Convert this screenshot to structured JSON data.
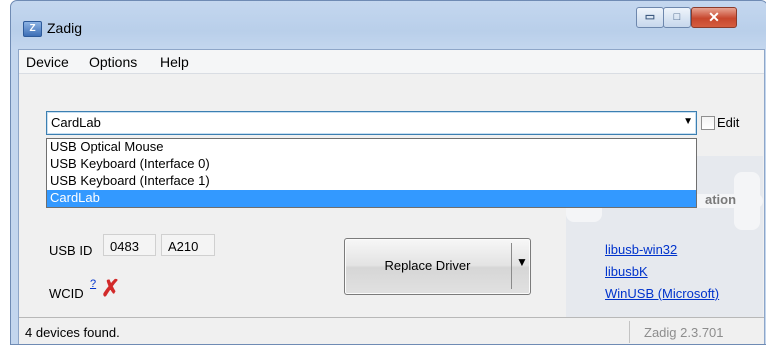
{
  "window": {
    "title": "Zadig",
    "icon_glyph": "Z",
    "min_glyph": "▭",
    "max_glyph": "□",
    "close_glyph": "✕"
  },
  "menu": {
    "items": [
      "Device",
      "Options",
      "Help"
    ]
  },
  "device_select": {
    "value": "CardLab",
    "options": [
      "USB Optical Mouse",
      "USB Keyboard (Interface 0)",
      "USB Keyboard (Interface 1)",
      "CardLab"
    ],
    "selected_index": 3,
    "arrow_glyph": "▼"
  },
  "edit": {
    "label": "Edit",
    "checked": false
  },
  "usb_id": {
    "label": "USB ID",
    "vid": "0483",
    "pid": "A210"
  },
  "wcid": {
    "label": "WCID",
    "help": "?",
    "status_glyph": "✗"
  },
  "replace_button": {
    "label": "Replace Driver",
    "arrow_glyph": "▼"
  },
  "driver_panel": {
    "heading_partial": "ation",
    "links": [
      "libusb-win32",
      "libusbK",
      "WinUSB (Microsoft)"
    ]
  },
  "status": {
    "left": "4 devices found.",
    "version": "Zadig 2.3.701"
  },
  "colors": {
    "selection": "#3399ff",
    "link": "#0033cc",
    "error": "#d22a2a"
  }
}
